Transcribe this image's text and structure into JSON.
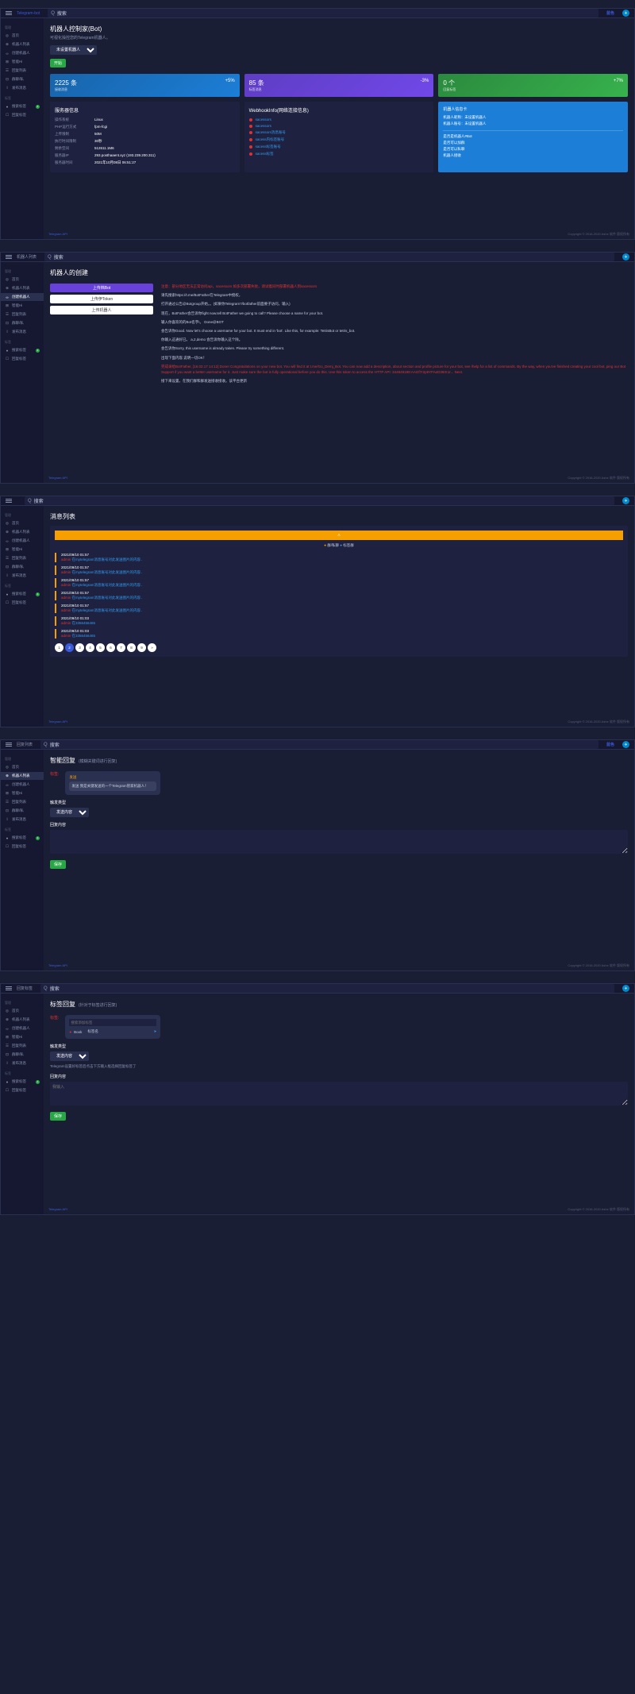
{
  "common": {
    "logo": "Telegram-bot",
    "search_placeholder": "搜索",
    "footer_left": "Telegram API",
    "footer_right": "Copyright © 2016-2020 Ashe 软件 版权所有",
    "blue_label": "蓝色"
  },
  "sidebar": {
    "cat1": "管理",
    "items": [
      {
        "icon": "◎",
        "label": "首页"
      },
      {
        "icon": "⊕",
        "label": "机器人列表"
      },
      {
        "icon": "∞",
        "label": "创建机器人"
      },
      {
        "icon": "⊞",
        "label": "智能Hi"
      },
      {
        "icon": "☰",
        "label": "回复列表"
      },
      {
        "icon": "⊡",
        "label": "群聊/私"
      },
      {
        "icon": "Ⅰ",
        "label": "发布消息"
      }
    ],
    "cat2": "标签",
    "items2": [
      {
        "icon": "●",
        "label": "搜索标签",
        "badge": "1"
      },
      {
        "icon": "☐",
        "label": "回复标签"
      }
    ]
  },
  "p1": {
    "title": "机器人控制家(Bot)",
    "subtitle": "可视化操控您的Telegram机器人。",
    "dropdown": "未设置机器人",
    "btn_start": "开始",
    "cards": [
      {
        "num": "2225 条",
        "label": "接收消息",
        "pct": "+5%"
      },
      {
        "num": "85 条",
        "label": "标签消息",
        "pct": "-3%"
      },
      {
        "num": "0 个",
        "label": "回复标签",
        "pct": "+7%"
      }
    ],
    "server": {
      "title": "服务器信息",
      "rows": [
        {
          "k": "操作系统",
          "v": "Linux"
        },
        {
          "k": "PHP运行方式",
          "v": "fpm-fcgi"
        },
        {
          "k": "上传限制",
          "v": "50M"
        },
        {
          "k": "执行时间限制",
          "v": "30秒"
        },
        {
          "k": "剩余空间",
          "v": "512611.1M6"
        },
        {
          "k": "服务器IP",
          "v": "293.posthaaent.xyz (193.239.200.311)"
        },
        {
          "k": "服务器时间",
          "v": "2021年10月08日 06:51:27"
        }
      ]
    },
    "webhook": {
      "title": "WebhookInfo(网络连接信息)",
      "items": [
        "sacessors",
        "sacessors",
        "sacessors消息账号",
        "sacess内标签账号",
        "sacess标签账号",
        "sacess标签"
      ]
    },
    "botcard": {
      "title": "机器人信息卡",
      "r1": "机器人昵称：未设置机器人",
      "r2": "机器人账号：未设置机器人",
      "sec1": "是否是机器人#Bot",
      "sec2": "是否可以加群",
      "sec3": "是否可以私聊",
      "sec4": "机器人接收"
    }
  },
  "p2": {
    "title": "机器人的创建",
    "btns": [
      "上传档Bot",
      "上传伊Token",
      "上传机器人"
    ],
    "lines": [
      "注意：部分地区无法正常访问api，sacessors 如多次部署失败，请试着同时部署机器人到sacessors",
      "请先搜索https://t.me/BotFather在Telegram中授权，",
      "打开通过公告@Botgroup开始。。(如果你Telegram?/botfather前面要子访问，输入)",
      "现在，BotFather会告诉你fight now.tell BotFather we going to call? Please choose a name for your bot.",
      "输入你喜欢的的Bot名字!。  Done@BOT",
      "会告诉你Good. Now let's choose a username for your bot. It must end in 'bot'. Like this, for example: TetrisBot or tetris_bot.",
      "你输入这通好已。 a,2,demo  会告诉你输入这个除。",
      "会告诉你Sorry, this username is already taken. Please try something different.",
      "出现下面内容,说明一切OK！",
      "完成录给BotFather, [16.02.17 14:12] Done! Congratulations on your new bot. You will find it at t.me/Go_Demj_Bot. You can now add a description, about section and profile picture for your bot, see /help for a list of commands. By the way, when you've finished creating your cool bot, ping our Bot Support if you want a better username for it. Just make sure the bot is fully operational before you do this. Use this token to access the HTTP API: 344849189:AAGf7r2p9YFAeD3ItrK1r... Next.",
      "接下来设置，在我们群和群发送接收接收。该平台更新"
    ]
  },
  "p3": {
    "title": "消息列表",
    "tabs": {
      "t1": "群/私聊",
      "t2": "标签群"
    },
    "msgs": [
      {
        "t": "2021/09/10 01:57",
        "u": "admin",
        "m": "在mytelegram消息账号对此发送图片的内容.."
      },
      {
        "t": "2021/09/10 01:57",
        "u": "admin",
        "m": "在mytelegram消息账号对此发送图片的内容.."
      },
      {
        "t": "2021/09/10 01:57",
        "u": "admin",
        "m": "在mytelegram消息账号对此发送图片的内容.."
      },
      {
        "t": "2021/09/10 01:57",
        "u": "admin",
        "m": "在mytelegram消息账号对此发送图片的内容.."
      },
      {
        "t": "2021/09/10 01:57",
        "u": "admin",
        "m": "在mytelegram消息账号对此发送图片的内容.."
      },
      {
        "t": "2021/09/10 01:03",
        "u": "admin",
        "m": "在3356456465"
      },
      {
        "t": "2021/09/10 01:03",
        "u": "admin",
        "m": "在3356456465"
      }
    ],
    "pages": [
      "1",
      "2",
      "3",
      "4",
      "5",
      "6",
      "7",
      "8",
      "9",
      "»"
    ]
  },
  "p4": {
    "title": "智能回复",
    "title_sub": "(模糊关键词进行回复)",
    "preview": {
      "label": "标签:",
      "keyword": "发送",
      "msg": "发送 我是关键发送的一个Telegram管家机器人！"
    },
    "trigger_label": "触发类型",
    "trigger_val": "发送内容",
    "content_label": "回复内容",
    "save": "保存"
  },
  "p5": {
    "title": "标签回复",
    "title_sub": "(针对于标签进行回复)",
    "preview": {
      "label": "标签:",
      "input": "搜索添加标签",
      "tag": "Book",
      "val": "标签名"
    },
    "trigger_label": "触发类型",
    "trigger_val": "发送内容",
    "hint": "Telegram设置好标签后点击下方输入框选择回复标签了",
    "content_label": "回复内容",
    "placeholder": "我输入",
    "save": "保存"
  }
}
